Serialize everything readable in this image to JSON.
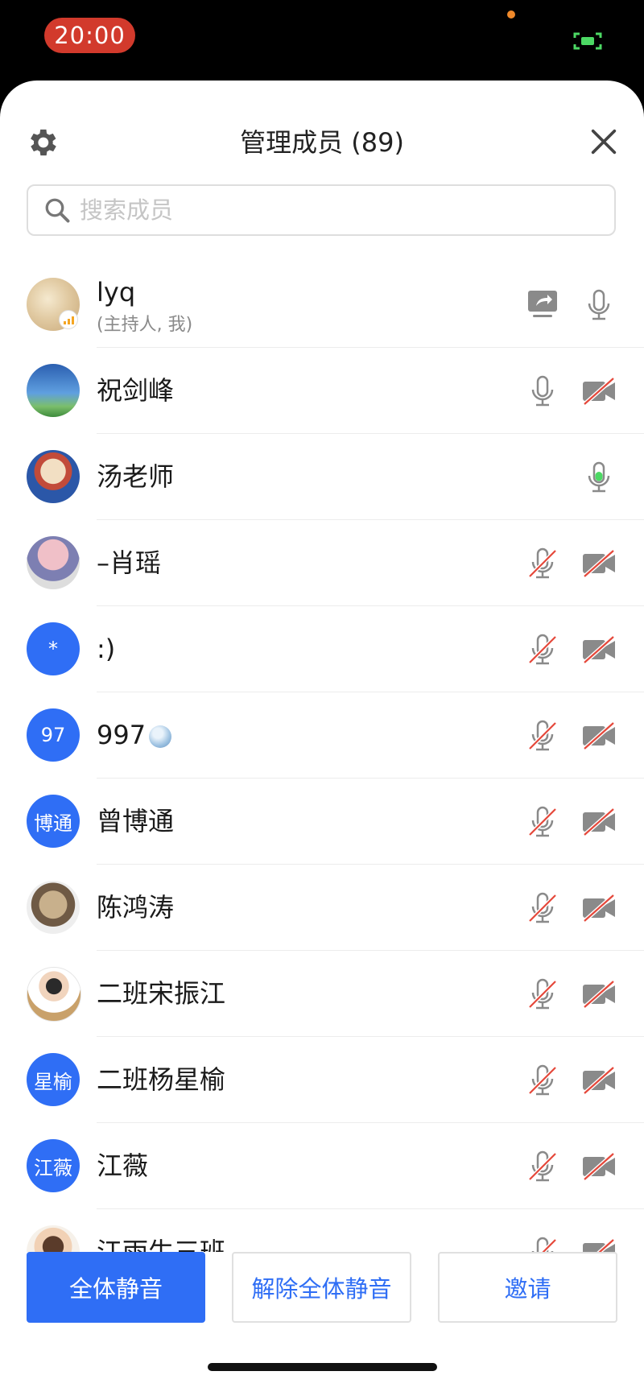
{
  "status_bar": {
    "time": "20:00"
  },
  "header": {
    "title": "管理成员 (89)"
  },
  "search": {
    "placeholder": "搜索成员"
  },
  "members": [
    {
      "name": "lyq",
      "role": "(主持人, 我)",
      "avatar": "photo",
      "mic": "on",
      "video": "none",
      "sharing": true
    },
    {
      "name": "祝剑峰",
      "avatar": "photo",
      "mic": "on",
      "video": "off"
    },
    {
      "name": "汤老师",
      "avatar": "photo",
      "mic": "speaking",
      "video": "none"
    },
    {
      "name": "–肖瑶",
      "avatar": "photo",
      "mic": "muted",
      "video": "off"
    },
    {
      "name": ":)",
      "avatar_text": "*",
      "mic": "muted",
      "video": "off"
    },
    {
      "name": "997",
      "avatar_text": "97",
      "mic": "muted",
      "video": "off"
    },
    {
      "name": "曾博通",
      "avatar_text": "博通",
      "mic": "muted",
      "video": "off"
    },
    {
      "name": "陈鸿涛",
      "avatar": "photo",
      "mic": "muted",
      "video": "off"
    },
    {
      "name": "二班宋振江",
      "avatar": "photo",
      "mic": "muted",
      "video": "off"
    },
    {
      "name": "二班杨星榆",
      "avatar_text": "星榆",
      "mic": "muted",
      "video": "off"
    },
    {
      "name": "江薇",
      "avatar_text": "江薇",
      "mic": "muted",
      "video": "off"
    },
    {
      "name": "江雨生三班",
      "avatar": "photo",
      "mic": "muted",
      "video": "off"
    }
  ],
  "actions": {
    "mute_all": "全体静音",
    "unmute_all": "解除全体静音",
    "invite": "邀请"
  },
  "colors": {
    "accent": "#2f6ef5",
    "muted_slash": "#e5483b",
    "speaking": "#4cd964",
    "time_pill": "#d23a2c"
  }
}
